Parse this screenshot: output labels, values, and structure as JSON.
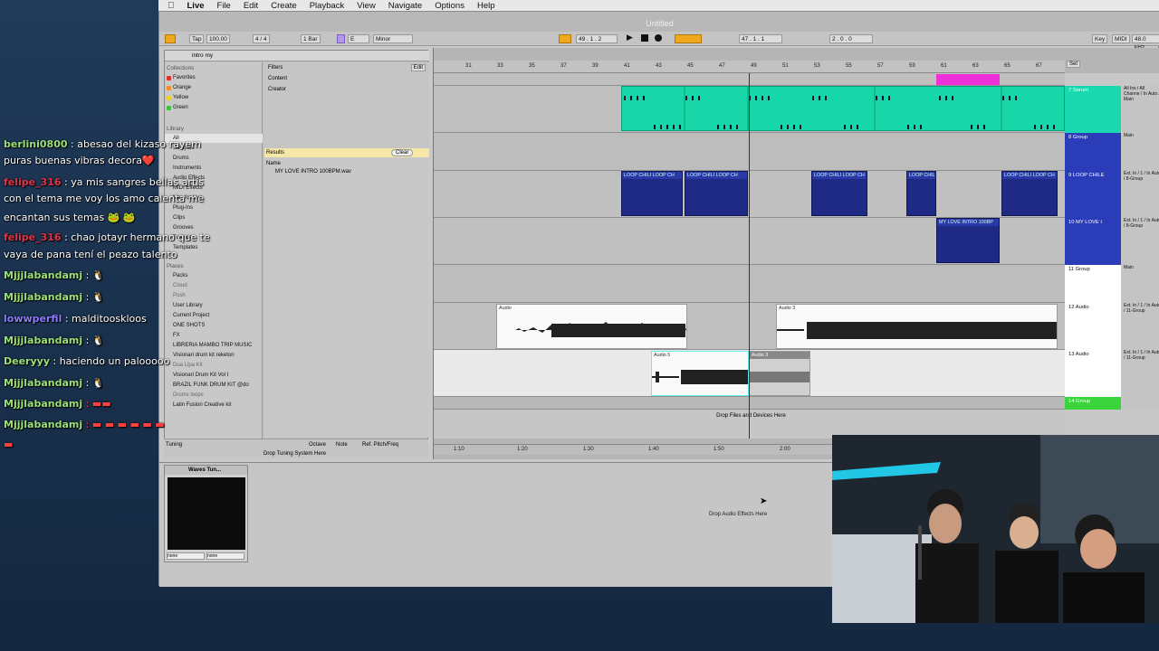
{
  "menubar": {
    "items": [
      "Live",
      "File",
      "Edit",
      "Create",
      "Playback",
      "View",
      "Navigate",
      "Options",
      "Help"
    ]
  },
  "window": {
    "title": "Untitled"
  },
  "control": {
    "tap": "Tap",
    "tempo": "100.00",
    "sig": "4 / 4",
    "quant": "1 Bar",
    "key": "E",
    "scale": "Minor",
    "pos": "49 .  1 .  2",
    "pos2": "47 .  1 .  1",
    "len": "2 .  0 .  0",
    "key_btn": "Key",
    "midi_btn": "MIDI",
    "rate": "48.0 kHz"
  },
  "browser": {
    "search": "intro my",
    "collections_header": "Collections",
    "collections": [
      "Favorites",
      "Orange",
      "Yellow",
      "Green"
    ],
    "library_header": "Library",
    "library": [
      "All",
      "Samples",
      "Drums",
      "Instruments",
      "Audio Effects",
      "MIDI Effects",
      "Max for Live",
      "Plug-Ins",
      "Clips",
      "Grooves",
      "Tunings",
      "Templates"
    ],
    "places_header": "Places",
    "places": [
      "Packs",
      "Cloud",
      "Push",
      "User Library",
      "Current Project",
      "ONE SHOTS",
      "FX",
      "LIBRERIA MAMBO TRIP MUSIC",
      "Visionari drum kit reketon",
      "Dua Lipa Kit",
      "Visionari Drum Kit Vol I",
      "BRAZIL FUNK DRUM KIT @do",
      "Drums loops",
      "Latin Fusion Creative kit"
    ],
    "filters": "Filters",
    "edit": "Edit",
    "content": "Content",
    "creator": "Creator",
    "results": "Results",
    "clear": "Clear",
    "name_col": "Name",
    "result_file": "MY LOVE INTRO 100BPM.wav"
  },
  "ruler": [
    "31",
    "33",
    "35",
    "37",
    "39",
    "41",
    "43",
    "45",
    "47",
    "49",
    "51",
    "53",
    "55",
    "57",
    "59",
    "61",
    "63",
    "65",
    "67"
  ],
  "tracks": {
    "loop_label": "LOOP CHILI LOOP CH",
    "loop_label_short": "LOOP CHILI",
    "intro_label": "MY LOVE INTRO 100BP",
    "audio_label": "Audio",
    "audio3_label": "Audio 3",
    "audio5_label": "Audio 5",
    "drop_files": "Drop Files and Devices Here"
  },
  "heads": [
    {
      "name": "7 Serum",
      "color": "#1ad9b0",
      "in": "All Ins",
      "ch": "All Channe",
      "mon": "In Auto",
      "out": "Main"
    },
    {
      "name": "8 Group",
      "color": "#2a3cb8",
      "in": "",
      "ch": "",
      "mon": "",
      "out": "Main"
    },
    {
      "name": "9 LOOP CHILE",
      "color": "#2a3cb8",
      "in": "Ext. In",
      "ch": "1",
      "mon": "In Auto",
      "out": "8-Group"
    },
    {
      "name": "10 MY LOVE I",
      "color": "#2a3cb8",
      "in": "Ext. In",
      "ch": "1",
      "mon": "In Auto",
      "out": "8-Group"
    },
    {
      "name": "11 Group",
      "color": "#ffffff",
      "in": "",
      "ch": "",
      "mon": "",
      "out": "Main"
    },
    {
      "name": "12 Audio",
      "color": "#ffffff",
      "in": "Ext. In",
      "ch": "1",
      "mon": "In Auto",
      "out": "11-Group"
    },
    {
      "name": "13 Audio",
      "color": "#ffffff",
      "in": "Ext. In",
      "ch": "1",
      "mon": "In Auto",
      "out": "11-Group"
    },
    {
      "name": "14 Group",
      "color": "#3cd43c",
      "in": "",
      "ch": "",
      "mon": "",
      "out": ""
    }
  ],
  "set_btn": "Set",
  "timeline": [
    "1:10",
    "1:20",
    "1:30",
    "1:40",
    "1:50",
    "2:00"
  ],
  "tuning": {
    "label": "Tuning",
    "octave": "Octave",
    "note": "Note",
    "ref": "Ref. Pitch/Freq",
    "drop": "Drop Tuning System Here"
  },
  "device": {
    "name": "Waves Tun...",
    "drop": "Drop Audio Effects Here",
    "sel1": "none",
    "sel2": "none"
  },
  "chat": [
    {
      "user": "berlini0800",
      "text": ": abesao del kizaso rayem",
      "color": "#9be07a"
    },
    {
      "user": "",
      "text": "puras buenas vibras decora❤️",
      "color": "#ffffff"
    },
    {
      "user": "felipe_316",
      "text": ": ya mis sangres bellas artis",
      "color": "#e0344a"
    },
    {
      "user": "",
      "text": "con el tema me voy los amo calenta me",
      "color": "#ffffff"
    },
    {
      "user": "",
      "text": "encantan sus temas 🐸 🐸",
      "color": "#ffffff"
    },
    {
      "user": "felipe_316",
      "text": ": chao jotayr hermano que te",
      "color": "#e0344a"
    },
    {
      "user": "",
      "text": "vaya de pana tení el peazo talento",
      "color": "#ffffff"
    },
    {
      "user": "Mjjjlabandamj",
      "text": ": 🐧",
      "color": "#9be07a"
    },
    {
      "user": "Mjjjlabandamj",
      "text": ": 🐧",
      "color": "#9be07a"
    },
    {
      "user": "lowwperfil",
      "text": ": malditooskloos",
      "color": "#8a7cff"
    },
    {
      "user": "Mjjjlabandamj",
      "text": ": 🐧",
      "color": "#9be07a"
    },
    {
      "user": "Deeryyy",
      "text": ": haciendo un palooooo",
      "color": "#9be07a"
    },
    {
      "user": "Mjjjlabandamj",
      "text": ": 🐧",
      "color": "#9be07a"
    },
    {
      "user": "Mjjjlabandamj",
      "text": ": ▬▬",
      "color": "#9be07a"
    },
    {
      "user": "Mjjjlabandamj",
      "text": ": ▬ ▬ ▬ ▬ ▬ ▬",
      "color": "#9be07a"
    },
    {
      "user": "",
      "text": "▬",
      "color": "#ff4040"
    }
  ]
}
